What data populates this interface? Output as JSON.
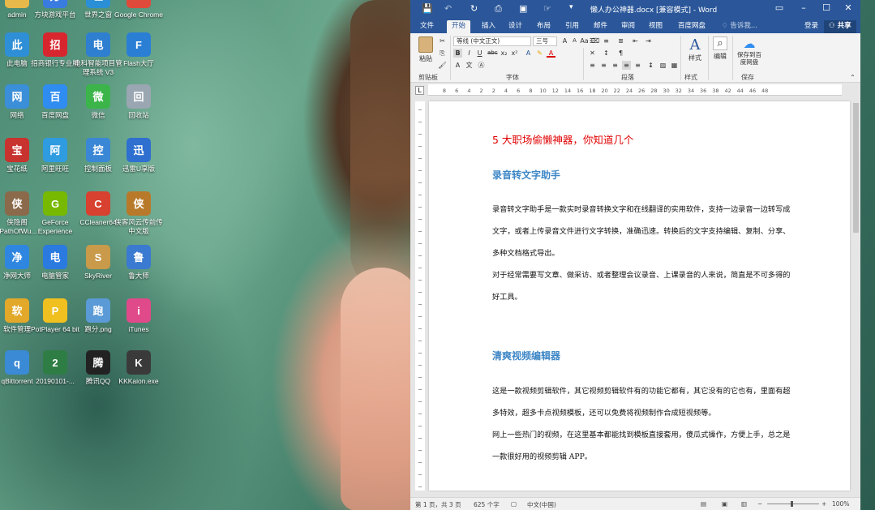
{
  "desktop": {
    "icons": [
      {
        "label": "admin",
        "icon": "user-folder-icon",
        "color": "#e7b84a"
      },
      {
        "label": "方块游戏平台",
        "icon": "game-icon",
        "color": "#3a7be0"
      },
      {
        "label": "世界之窗",
        "icon": "globe-icon",
        "color": "#2a8fd6"
      },
      {
        "label": "Google Chrome",
        "icon": "chrome-icon",
        "color": "#e04a3a"
      },
      {
        "label": "此电脑",
        "icon": "computer-icon",
        "color": "#2f8fd6"
      },
      {
        "label": "招商银行专业版",
        "icon": "bank-icon",
        "color": "#d8262f"
      },
      {
        "label": "电科智能项目管理系统 V3",
        "icon": "project-icon",
        "color": "#2e7fd0"
      },
      {
        "label": "Flash大厅",
        "icon": "flash-icon",
        "color": "#2a7fd4"
      },
      {
        "label": "网络",
        "icon": "network-icon",
        "color": "#3b8fd8"
      },
      {
        "label": "百度网盘",
        "icon": "cloud-icon",
        "color": "#2f8cf0"
      },
      {
        "label": "微信",
        "icon": "wechat-icon",
        "color": "#3bb54a"
      },
      {
        "label": "回收站",
        "icon": "recycle-bin-icon",
        "color": "#9aa6b2"
      },
      {
        "label": "宝花纸",
        "icon": "cards-icon",
        "color": "#c8322f"
      },
      {
        "label": "阿里旺旺",
        "icon": "chat-icon",
        "color": "#2f9be0"
      },
      {
        "label": "控制面板",
        "icon": "control-panel-icon",
        "color": "#3a87d6"
      },
      {
        "label": "迅雷U享版",
        "icon": "thunder-icon",
        "color": "#2e6fd0"
      },
      {
        "label": "侠隐阁 (PathOfWu...",
        "icon": "game-char-icon",
        "color": "#8a6a4a"
      },
      {
        "label": "GeForce Experience",
        "icon": "nvidia-icon",
        "color": "#76b900"
      },
      {
        "label": "CCleaner64",
        "icon": "ccleaner-icon",
        "color": "#d8402f"
      },
      {
        "label": "侠客风云传前传中文版",
        "icon": "game-logo-icon",
        "color": "#b87a2a"
      },
      {
        "label": "净网大师",
        "icon": "shield-a-icon",
        "color": "#2f86e0"
      },
      {
        "label": "电脑管家",
        "icon": "shield-icon",
        "color": "#2a7ae0"
      },
      {
        "label": "SkyRiver",
        "icon": "skyriver-icon",
        "color": "#c89a4a"
      },
      {
        "label": "鲁大师",
        "icon": "master-lu-icon",
        "color": "#3a7ad0"
      },
      {
        "label": "软件管理",
        "icon": "software-icon",
        "color": "#e2a82a"
      },
      {
        "label": "PotPlayer 64 bit",
        "icon": "potplayer-icon",
        "color": "#f0c020"
      },
      {
        "label": "跑分.png",
        "icon": "image-file-icon",
        "color": "#5a9ad6"
      },
      {
        "label": "iTunes",
        "icon": "itunes-icon",
        "color": "#e04a8a"
      },
      {
        "label": "qBittorrent",
        "icon": "qbittorrent-icon",
        "color": "#3a8ad6"
      },
      {
        "label": "20190101-...",
        "icon": "excel-file-icon",
        "color": "#2e7d45"
      },
      {
        "label": "腾讯QQ",
        "icon": "qq-icon",
        "color": "#222222"
      },
      {
        "label": "KKKaion.exe",
        "icon": "kkaion-icon",
        "color": "#3a3a3a"
      }
    ]
  },
  "word": {
    "title": "懒人办公神器.docx [兼容模式] - Word",
    "tabs": [
      "文件",
      "开始",
      "插入",
      "设计",
      "布局",
      "引用",
      "邮件",
      "审阅",
      "视图",
      "百度网盘"
    ],
    "search_hint": "告诉我...",
    "login": "登录",
    "share": "共享",
    "ribbon": {
      "paste": "粘贴",
      "clipboard": "剪贴板",
      "font_name": "等线 (中文正文)",
      "font_size": "三号",
      "font_group": "字体",
      "paragraph_group": "段落",
      "styles": "样式",
      "styles_group": "样式",
      "edit": "编辑",
      "save_to_baidu": "保存到百度网盘",
      "save_group": "保存"
    },
    "ruler_numbers": [
      "8",
      "6",
      "4",
      "2",
      "2",
      "4",
      "6",
      "8",
      "10",
      "12",
      "14",
      "16",
      "18",
      "20",
      "22",
      "24",
      "26",
      "28",
      "30",
      "32",
      "34",
      "36",
      "38",
      "42",
      "44",
      "46",
      "48"
    ],
    "document": {
      "heading": "5 大职场偷懒神器，你知道几个",
      "section1_title": "录音转文字助手",
      "section1_p1": "录音转文字助手是一款实时录音转换文字和在线翻译的实用软件，支持一边录音一边转写成文字，或者上传录音文件进行文字转换，准确迅速。转换后的文字支持编辑、复制、分享、多种文档格式导出。",
      "section1_p2": "对于经常需要写文章、做采访、或者整理会议录音、上课录音的人来说，简直是不可多得的好工具。",
      "section2_title": "清爽视频编辑器",
      "section2_p1": "这是一款视频剪辑软件，其它视频剪辑软件有的功能它都有，其它没有的它也有，里面有超多特效，超多卡点视频模板，还可以免费将视频制作合成短视频等。",
      "section2_p2": "网上一些热门的视频，在这里基本都能找到模板直接套用，傻瓜式操作，方便上手，总之是一款很好用的视频剪辑 APP。"
    },
    "status": {
      "page": "第 1 页，共 3 页",
      "words": "625 个字",
      "language": "中文(中国)",
      "zoom": "100%"
    }
  }
}
